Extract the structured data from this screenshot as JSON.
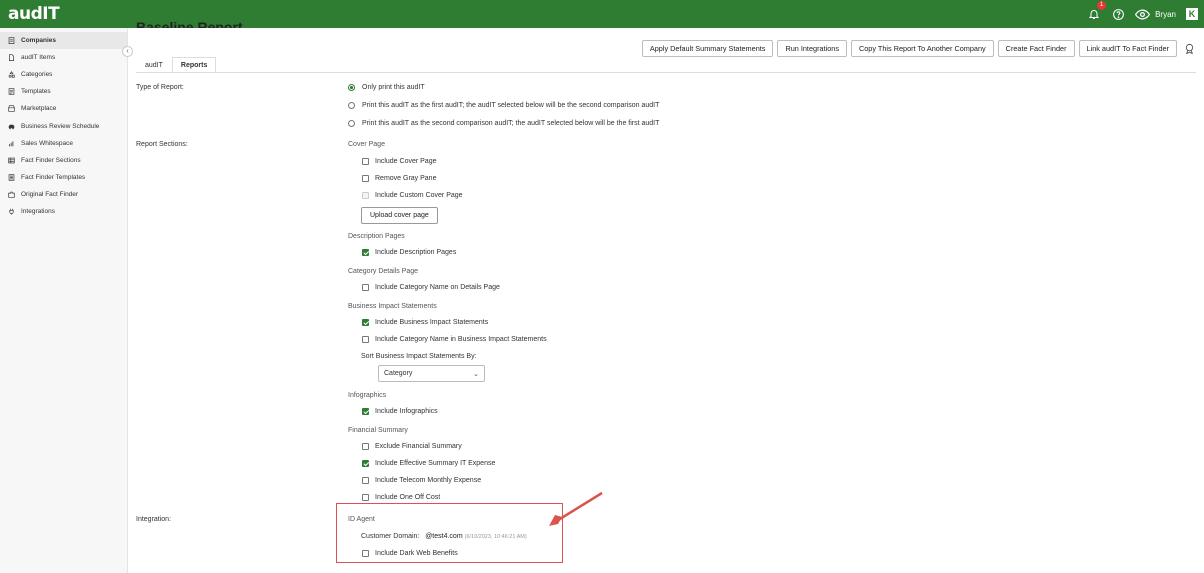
{
  "app": {
    "logo": "audIT",
    "notifications_count": "1",
    "user_name": "Bryan",
    "brand_mark": "K"
  },
  "sidebar": {
    "items": [
      {
        "label": "Companies",
        "icon": "clipboard-icon"
      },
      {
        "label": "audIT Items",
        "icon": "document-icon"
      },
      {
        "label": "Categories",
        "icon": "categories-icon"
      },
      {
        "label": "Templates",
        "icon": "template-icon"
      },
      {
        "label": "Marketplace",
        "icon": "store-icon"
      },
      {
        "label": "Business Review Schedule",
        "icon": "car-icon"
      },
      {
        "label": "Sales Whitespace",
        "icon": "bar-chart-icon"
      },
      {
        "label": "Fact Finder Sections",
        "icon": "table-icon"
      },
      {
        "label": "Fact Finder Templates",
        "icon": "form-icon"
      },
      {
        "label": "Original Fact Finder",
        "icon": "puzzle-icon"
      },
      {
        "label": "Integrations",
        "icon": "plug-icon"
      }
    ],
    "collapse_icon": "chevron-left-icon"
  },
  "page": {
    "title": "Baseline Report"
  },
  "actions": {
    "apply_default": "Apply Default Summary Statements",
    "run_integrations": "Run Integrations",
    "copy_report": "Copy This Report To Another Company",
    "create_fact_finder": "Create Fact Finder",
    "link_audit": "Link audIT To Fact Finder"
  },
  "tabs": [
    {
      "label": "audIT"
    },
    {
      "label": "Reports"
    }
  ],
  "type_of_report": {
    "label": "Type of Report:",
    "options": [
      "Only print this audIT",
      "Print this audIT as the first audIT; the audIT selected below will be the second comparison audIT",
      "Print this audIT as the second comparison audIT; the audIT selected below will be the first audIT"
    ],
    "selected": 0
  },
  "report_sections": {
    "label": "Report Sections:",
    "cover_page": {
      "heading": "Cover Page",
      "include_cover_page": "Include Cover Page",
      "remove_gray_pane": "Remove Gray Pane",
      "include_custom_cover_page": "Include Custom Cover Page",
      "upload_button": "Upload cover page"
    },
    "description_pages": {
      "heading": "Description Pages",
      "include_description_pages": "Include Description Pages"
    },
    "category_details": {
      "heading": "Category Details Page",
      "include_category_name": "Include Category Name on Details Page"
    },
    "business_impact": {
      "heading": "Business Impact Statements",
      "include_bis": "Include Business Impact Statements",
      "include_category_name_bis": "Include Category Name in Business Impact Statements",
      "sort_label": "Sort Business Impact Statements By:",
      "sort_value": "Category"
    },
    "infographics": {
      "heading": "Infographics",
      "include_infographics": "Include Infographics"
    },
    "financial_summary": {
      "heading": "Financial Summary",
      "exclude_financial_summary": "Exclude Financial Summary",
      "include_effective_summary": "Include Effective Summary IT Expense",
      "include_telecom": "Include Telecom Monthly Expense",
      "include_one_off": "Include One Off Cost"
    }
  },
  "integration": {
    "label": "Integration:",
    "id_agent": "ID Agent",
    "customer_domain_label": "Customer Domain:",
    "customer_domain_value": "@test4.com",
    "customer_domain_timestamp": "(6/10/2023, 10:46:21 AM)",
    "include_dark_web": "Include Dark Web Benefits"
  },
  "colors": {
    "brand": "#2e7d32",
    "annotation": "#d9534f"
  }
}
